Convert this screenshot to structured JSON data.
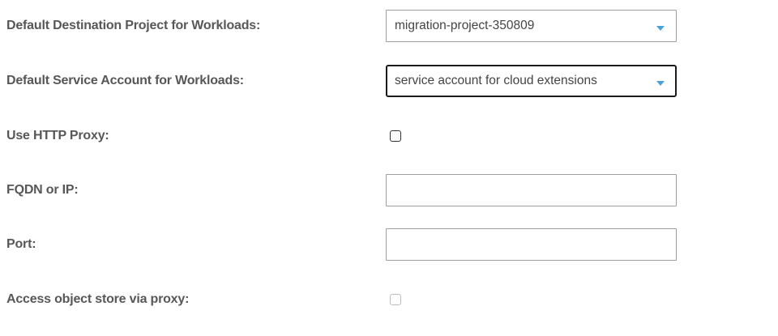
{
  "form": {
    "destination_project": {
      "label": "Default Destination Project for Workloads:",
      "value": "migration-project-350809"
    },
    "service_account": {
      "label": "Default Service Account for Workloads:",
      "value": "service account for cloud extensions"
    },
    "http_proxy": {
      "label": "Use HTTP Proxy:",
      "checked": false
    },
    "fqdn": {
      "label": "FQDN or IP:",
      "value": "",
      "placeholder": ""
    },
    "port": {
      "label": "Port:",
      "value": "",
      "placeholder": ""
    },
    "object_store_proxy": {
      "label": "Access object store via proxy:",
      "checked": false,
      "disabled": true
    }
  },
  "colors": {
    "label_text": "#575757",
    "input_border": "#9e9e9e",
    "focused_border": "#1b1b1b",
    "caret_accent": "#4aa3d8"
  }
}
